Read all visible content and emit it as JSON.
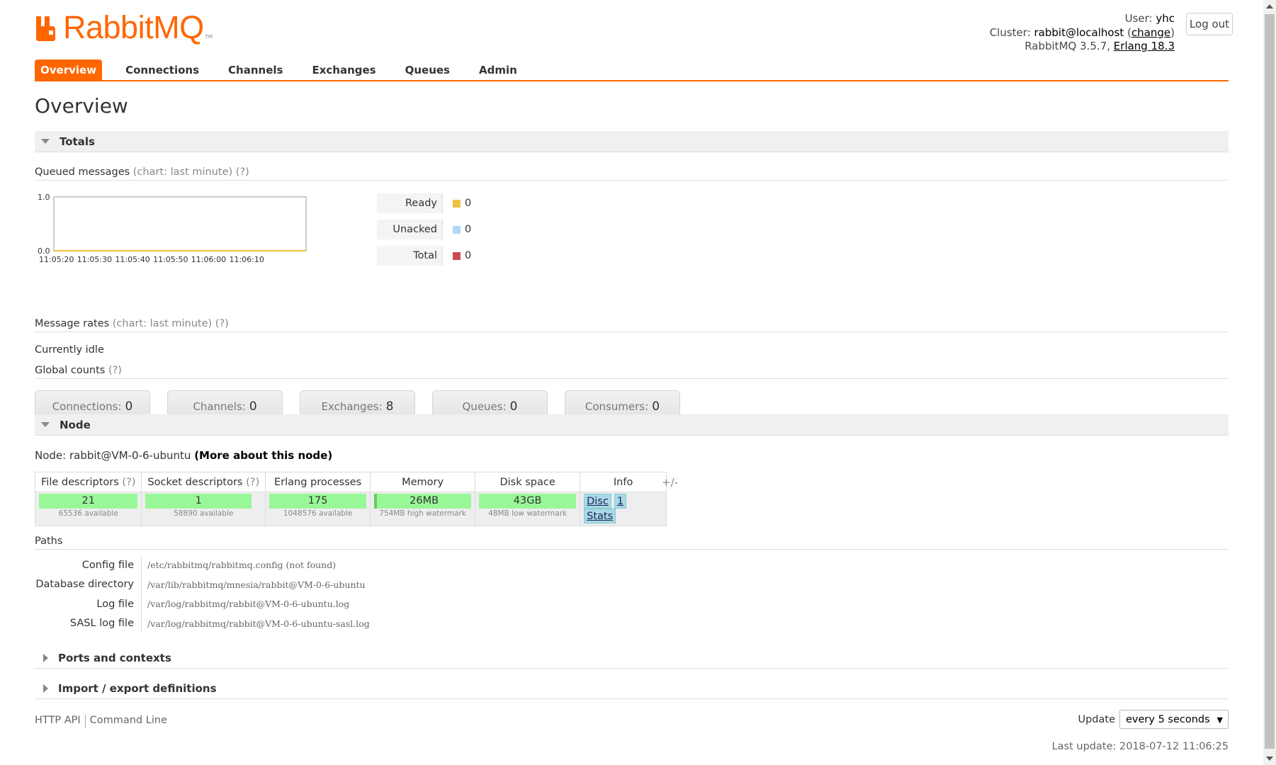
{
  "header": {
    "logo_text": "RabbitMQ",
    "logo_tm": "TM",
    "user_label": "User:",
    "user_value": "yhc",
    "cluster_label": "Cluster:",
    "cluster_value": "rabbit@localhost",
    "cluster_change": "change",
    "version_text": "RabbitMQ 3.5.7,",
    "erlang_link": "Erlang 18.3",
    "logout_label": "Log out"
  },
  "tabs": [
    {
      "label": "Overview",
      "active": true
    },
    {
      "label": "Connections"
    },
    {
      "label": "Channels"
    },
    {
      "label": "Exchanges"
    },
    {
      "label": "Queues"
    },
    {
      "label": "Admin"
    }
  ],
  "page_title": "Overview",
  "totals": {
    "heading": "Totals",
    "queued_label": "Queued messages",
    "queued_chart_note": "(chart: last minute)",
    "queued_help": "(?)",
    "legend": [
      {
        "label": "Ready",
        "value": "0",
        "color": "#edc240"
      },
      {
        "label": "Unacked",
        "value": "0",
        "color": "#afd8f8"
      },
      {
        "label": "Total",
        "value": "0",
        "color": "#cb4b4b"
      }
    ],
    "rates_label": "Message rates",
    "rates_chart_note": "(chart: last minute)",
    "rates_help": "(?)",
    "idle_text": "Currently idle",
    "global_label": "Global counts",
    "global_help": "(?)",
    "counts": [
      {
        "label": "Connections:",
        "value": "0"
      },
      {
        "label": "Channels:",
        "value": "0"
      },
      {
        "label": "Exchanges:",
        "value": "8"
      },
      {
        "label": "Queues:",
        "value": "0"
      },
      {
        "label": "Consumers:",
        "value": "0"
      }
    ]
  },
  "chart_data": {
    "type": "line",
    "x": [
      "11:05:20",
      "11:05:30",
      "11:05:40",
      "11:05:50",
      "11:06:00",
      "11:06:10"
    ],
    "yticks": [
      "1.0",
      "0.0"
    ],
    "ylim": [
      0,
      1
    ],
    "series": [
      {
        "name": "Ready",
        "values": [
          0,
          0,
          0,
          0,
          0,
          0
        ],
        "color": "#edc240"
      },
      {
        "name": "Unacked",
        "values": [
          0,
          0,
          0,
          0,
          0,
          0
        ],
        "color": "#afd8f8"
      },
      {
        "name": "Total",
        "values": [
          0,
          0,
          0,
          0,
          0,
          0
        ],
        "color": "#cb4b4b"
      }
    ]
  },
  "node": {
    "heading": "Node",
    "node_label": "Node:",
    "node_name": "rabbit@VM-0-6-ubuntu",
    "more_link": "(More about this node)",
    "columns": [
      {
        "label": "File descriptors",
        "help": "(?)"
      },
      {
        "label": "Socket descriptors",
        "help": "(?)"
      },
      {
        "label": "Erlang processes",
        "help": ""
      },
      {
        "label": "Memory",
        "help": ""
      },
      {
        "label": "Disk space",
        "help": ""
      },
      {
        "label": "Info",
        "help": ""
      }
    ],
    "cells": [
      {
        "value": "21",
        "sub": "65536 available"
      },
      {
        "value": "1",
        "sub": "58890 available"
      },
      {
        "value": "175",
        "sub": "1048576 available"
      },
      {
        "value": "26MB",
        "sub": "754MB high watermark"
      },
      {
        "value": "43GB",
        "sub": "48MB low watermark"
      }
    ],
    "info_tags": [
      "Disc",
      "1",
      "Stats"
    ],
    "plus_minus": "+/-",
    "paths_label": "Paths",
    "paths": [
      {
        "key": "Config file",
        "value": "/etc/rabbitmq/rabbitmq.config (not found)"
      },
      {
        "key": "Database directory",
        "value": "/var/lib/rabbitmq/mnesia/rabbit@VM-0-6-ubuntu"
      },
      {
        "key": "Log file",
        "value": "/var/log/rabbitmq/rabbit@VM-0-6-ubuntu.log"
      },
      {
        "key": "SASL log file",
        "value": "/var/log/rabbitmq/rabbit@VM-0-6-ubuntu-sasl.log"
      }
    ]
  },
  "collapsed_sections": [
    "Ports and contexts",
    "Import / export definitions"
  ],
  "footer": {
    "links": [
      "HTTP API",
      "Command Line"
    ],
    "update_label": "Update",
    "update_value": "every 5 seconds",
    "last_update": "Last update: 2018-07-12 11:06:25"
  }
}
